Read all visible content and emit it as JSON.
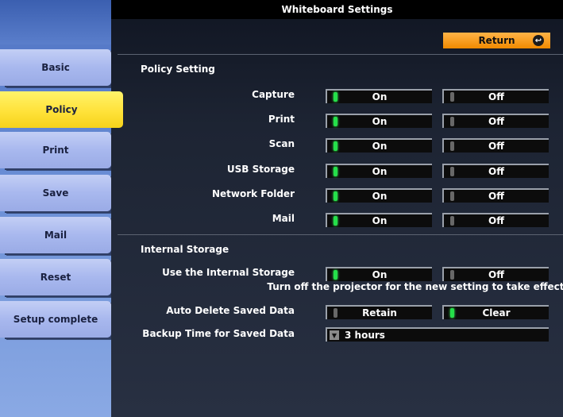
{
  "window": {
    "title": "Whiteboard Settings"
  },
  "sidebar": {
    "items": [
      {
        "label": "Basic",
        "active": false
      },
      {
        "label": "Policy",
        "active": true
      },
      {
        "label": "Print",
        "active": false
      },
      {
        "label": "Save",
        "active": false
      },
      {
        "label": "Mail",
        "active": false
      },
      {
        "label": "Reset",
        "active": false
      },
      {
        "label": "Setup complete",
        "active": false
      }
    ]
  },
  "header": {
    "return_label": "Return",
    "return_icon": "return-icon"
  },
  "policy": {
    "title": "Policy Setting",
    "rows": [
      {
        "label": "Capture",
        "on_label": "On",
        "off_label": "Off",
        "selected": "On"
      },
      {
        "label": "Print",
        "on_label": "On",
        "off_label": "Off",
        "selected": "On"
      },
      {
        "label": "Scan",
        "on_label": "On",
        "off_label": "Off",
        "selected": "On"
      },
      {
        "label": "USB Storage",
        "on_label": "On",
        "off_label": "Off",
        "selected": "On"
      },
      {
        "label": "Network Folder",
        "on_label": "On",
        "off_label": "Off",
        "selected": "On"
      },
      {
        "label": "Mail",
        "on_label": "On",
        "off_label": "Off",
        "selected": "On"
      }
    ]
  },
  "storage": {
    "title": "Internal Storage",
    "use": {
      "label": "Use the Internal Storage",
      "on_label": "On",
      "off_label": "Off",
      "selected": "On"
    },
    "notice": "Turn off the projector for the new setting to take effect.",
    "auto_delete": {
      "label": "Auto Delete Saved Data",
      "retain_label": "Retain",
      "clear_label": "Clear",
      "selected": "Clear"
    },
    "backup": {
      "label": "Backup Time for Saved Data",
      "value": "3 hours"
    }
  },
  "colors": {
    "accent": "#f08a00",
    "active_tab": "#ffe23a",
    "indicator_on": "#25e04a"
  }
}
